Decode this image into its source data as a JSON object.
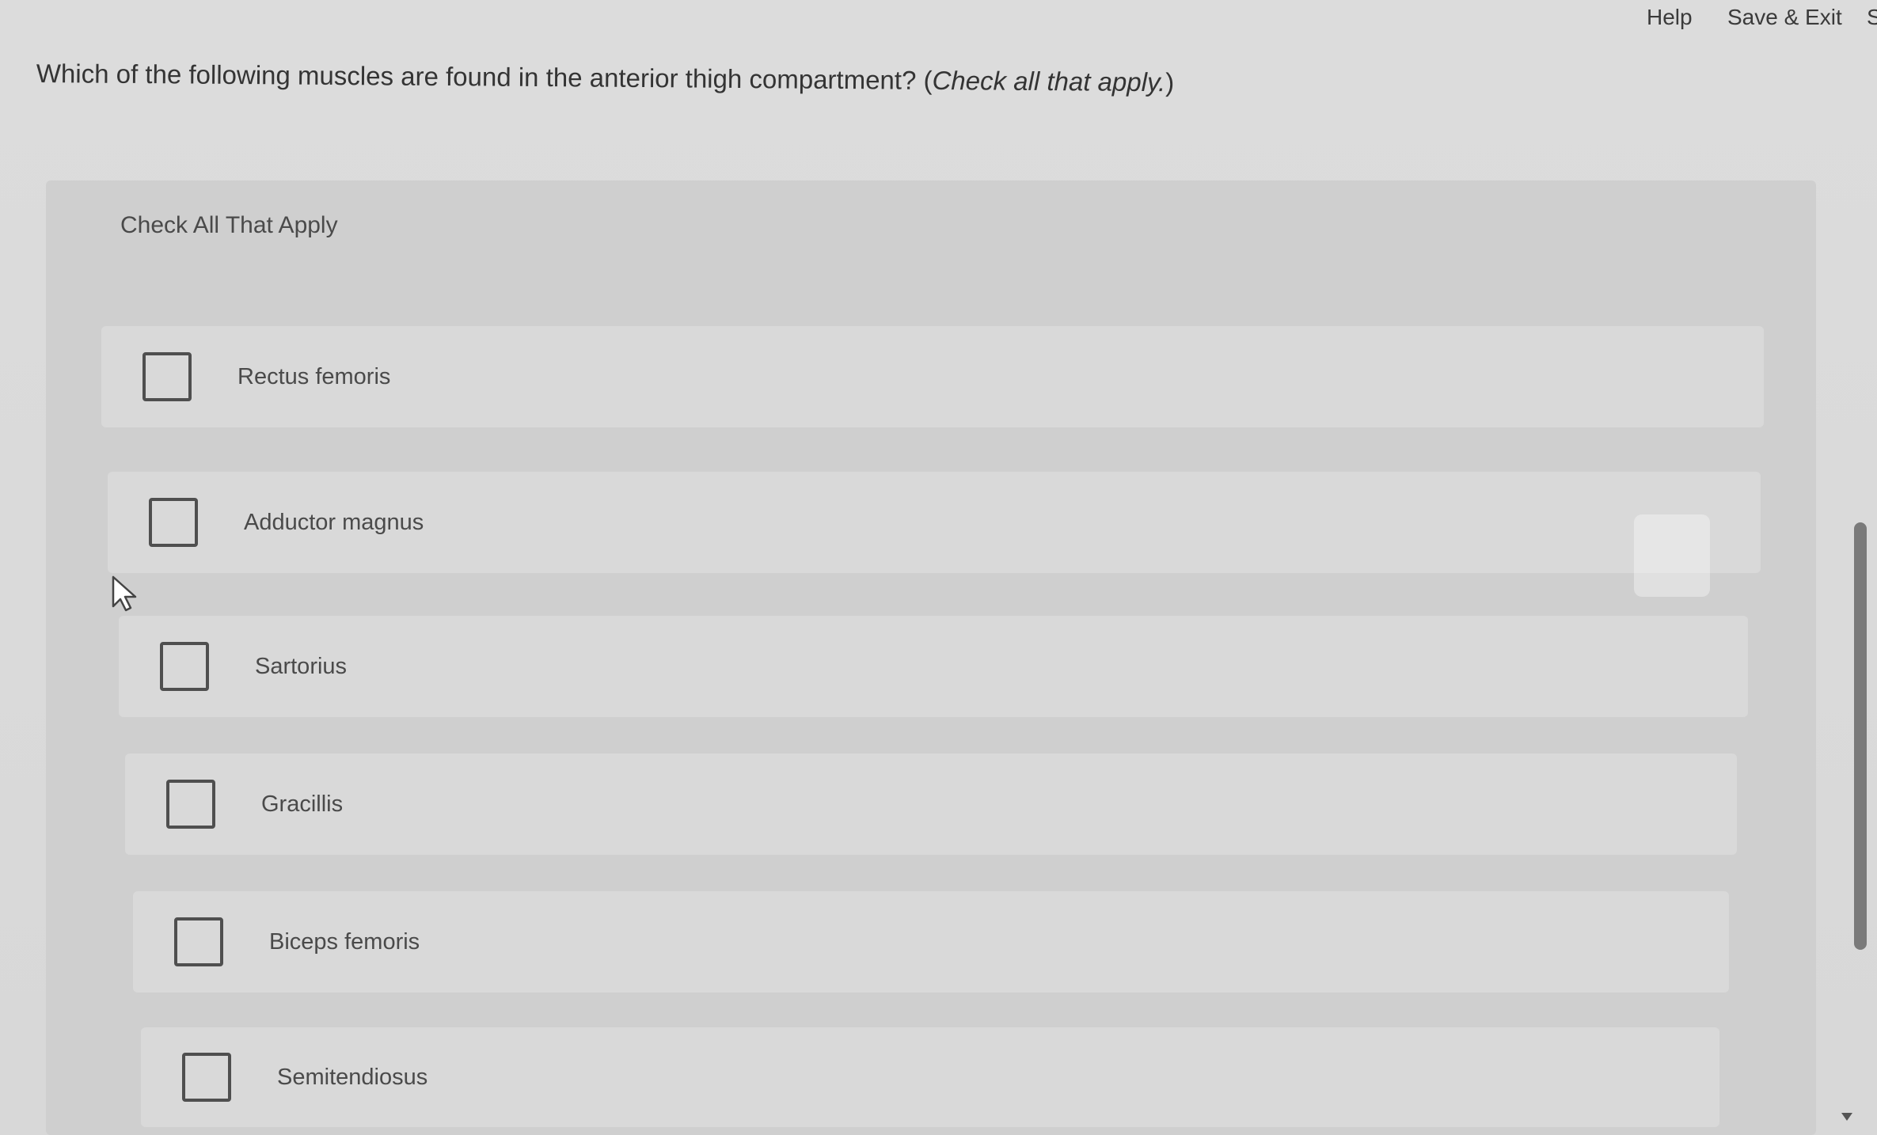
{
  "topbar": {
    "help_label": "Help",
    "save_exit_label": "Save & Exit",
    "submit_label": "S"
  },
  "question": {
    "text": "Which of the following muscles are found in the anterior thigh compartment? (",
    "instruction": "Check all that apply.",
    "close_paren": ")"
  },
  "panel": {
    "header": "Check All That Apply"
  },
  "options": [
    {
      "label": "Rectus femoris",
      "checked": false
    },
    {
      "label": "Adductor magnus",
      "checked": false
    },
    {
      "label": "Sartorius",
      "checked": false
    },
    {
      "label": "Gracillis",
      "checked": false
    },
    {
      "label": "Biceps femoris",
      "checked": false
    },
    {
      "label": "Semitendiosus",
      "checked": false
    }
  ],
  "colors": {
    "background": "#dcdcdc",
    "panel": "#cfcfcf",
    "option": "#d9d9d9",
    "checkbox_border": "#4f4f4f",
    "text": "#343434"
  },
  "icons": {
    "cursor": "arrow-cursor-icon",
    "scroll": "chevron-down-icon"
  }
}
